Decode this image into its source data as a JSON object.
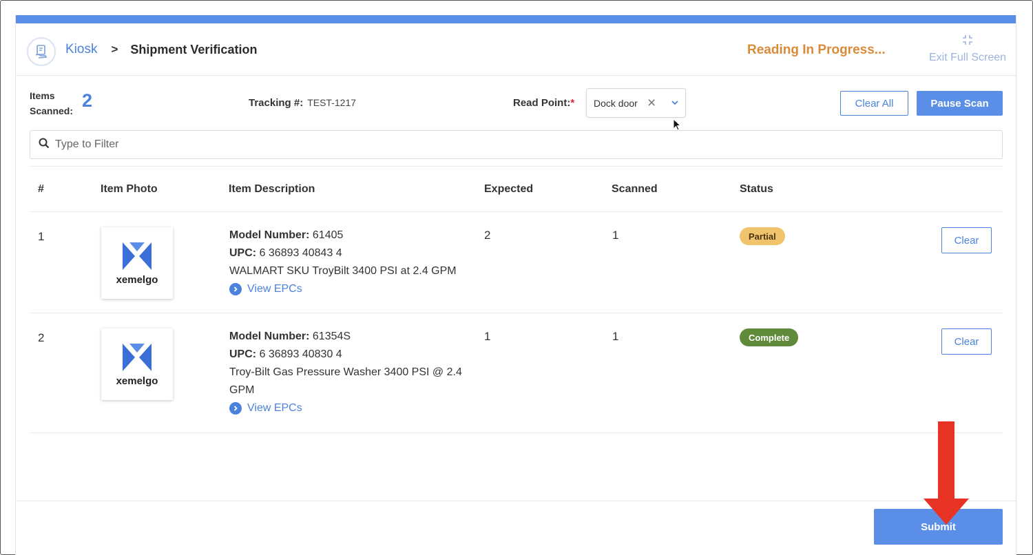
{
  "header": {
    "breadcrumb_root": "Kiosk",
    "breadcrumb_sep": ">",
    "page_title": "Shipment Verification",
    "status_text": "Reading In Progress...",
    "exit_fullscreen": "Exit Full Screen"
  },
  "summary": {
    "items_label_1": "Items",
    "items_label_2": "Scanned:",
    "items_count": "2",
    "tracking_label": "Tracking #:",
    "tracking_value": "TEST-1217",
    "read_point_label": "Read Point:",
    "read_point_required": "*",
    "read_point_value": "Dock door",
    "clear_all": "Clear All",
    "pause_scan": "Pause Scan"
  },
  "filter": {
    "placeholder": "Type to Filter"
  },
  "table": {
    "columns": [
      "#",
      "Item Photo",
      "Item Description",
      "Expected",
      "Scanned",
      "Status"
    ],
    "rows": [
      {
        "index": "1",
        "photo_brand": "xemelgo",
        "model_label": "Model Number:",
        "model": "61405",
        "upc_label": "UPC:",
        "upc": "6 36893 40843 4",
        "description": "WALMART SKU TroyBilt 3400 PSI at 2.4 GPM",
        "view_epcs": "View EPCs",
        "expected": "2",
        "scanned": "1",
        "status": "Partial",
        "clear": "Clear"
      },
      {
        "index": "2",
        "photo_brand": "xemelgo",
        "model_label": "Model Number:",
        "model": "61354S",
        "upc_label": "UPC:",
        "upc": "6 36893 40830 4",
        "description": "Troy-Bilt Gas Pressure Washer 3400 PSI @ 2.4 GPM",
        "view_epcs": "View EPCs",
        "expected": "1",
        "scanned": "1",
        "status": "Complete",
        "clear": "Clear"
      }
    ]
  },
  "footer": {
    "submit": "Submit"
  },
  "colors": {
    "accent": "#5b8ee6",
    "status_progress": "#d98b3a",
    "partial": "#f0c36d",
    "complete": "#5e8a3a",
    "annotation_arrow": "#e63324"
  },
  "icons": [
    "kiosk-icon",
    "exit-fullscreen-icon",
    "clear-x-icon",
    "chevron-down-icon",
    "search-icon",
    "chevron-right-circle-icon",
    "xemelgo-logo",
    "red-arrow-annotation"
  ]
}
